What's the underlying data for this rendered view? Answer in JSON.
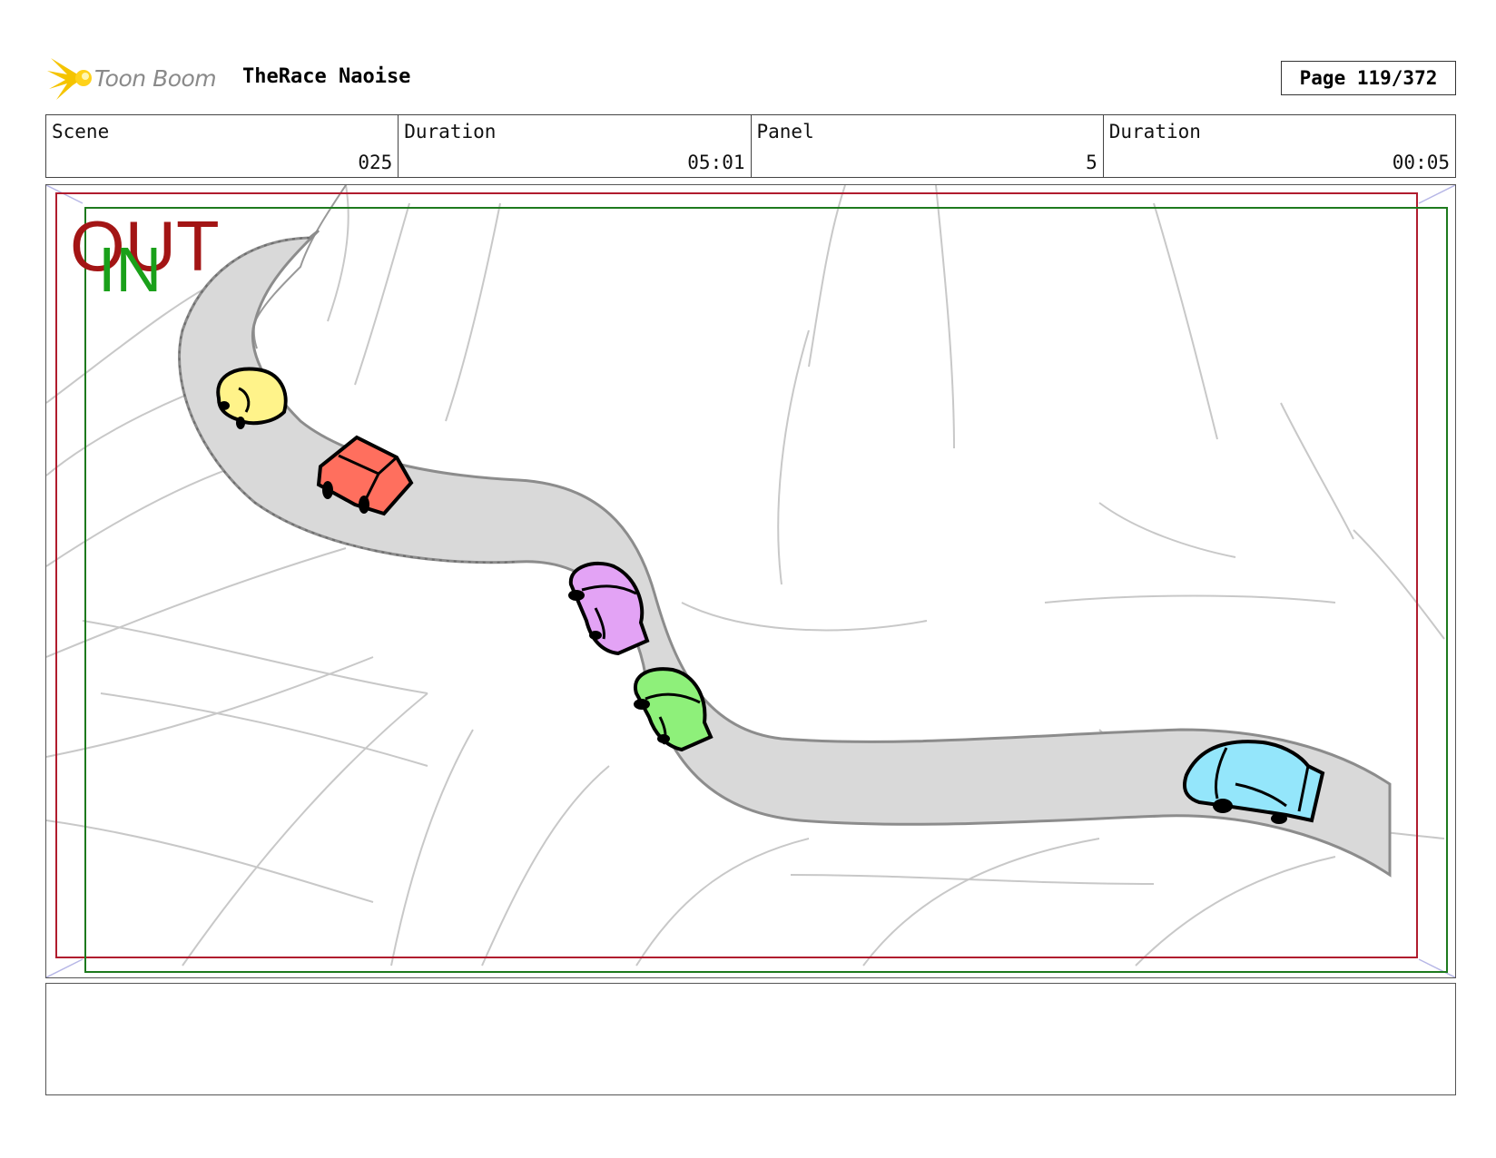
{
  "header": {
    "logo_text": "Toon Boom",
    "project_title": "TheRace Naoise",
    "page_label": "Page 119/372"
  },
  "info": {
    "scene_label": "Scene",
    "scene_value": "025",
    "duration1_label": "Duration",
    "duration1_value": "05:01",
    "panel_label": "Panel",
    "panel_value": "5",
    "duration2_label": "Duration",
    "duration2_value": "00:05"
  },
  "panel": {
    "out_label": "OUT",
    "in_label": "IN",
    "colors": {
      "out_frame": "#b01c2e",
      "in_frame": "#1e7a1e",
      "road": "#d9d9d9",
      "car_yellow": "#fff38a",
      "car_red": "#ff6f5e",
      "car_purple": "#e3a3f5",
      "car_green": "#8ef07a",
      "car_blue": "#94e6fb"
    }
  },
  "notes": {}
}
